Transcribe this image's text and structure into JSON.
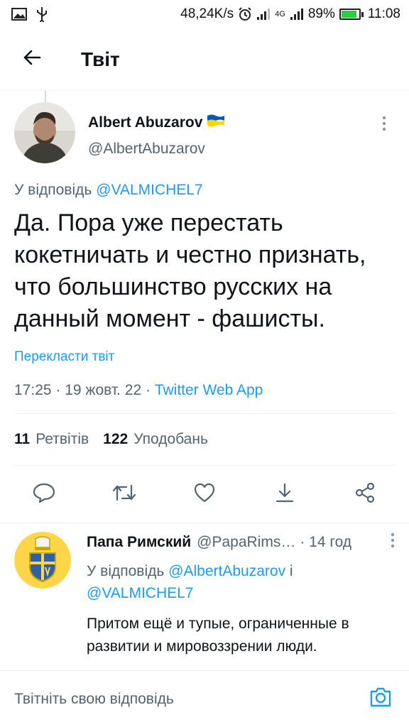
{
  "status_bar": {
    "speed": "48,24K/s",
    "network": "4G",
    "battery": "89%",
    "battery_level": 0.89,
    "time": "11:08"
  },
  "header": {
    "title": "Твіт"
  },
  "tweet": {
    "author_name": "Albert Abuzarov",
    "author_handle": "@AlbertAbuzarov",
    "reply_prefix": "У відповідь",
    "reply_to": "@VALMICHEL7",
    "text": "Да. Пора уже перестать кокетничать и честно признать, что большинство русских на данный момент - фашисты.",
    "translate": "Перекласти твіт",
    "meta": "17:25 · 19 жовт. 22 · ",
    "source": "Twitter Web App",
    "retweets_count": "11",
    "retweets_label": "Ретвітів",
    "likes_count": "122",
    "likes_label": "Уподобань"
  },
  "reply": {
    "name": "Папа Римский",
    "handle": "@PapaRims…",
    "time": "· 14 год",
    "reply_prefix": "У відповідь",
    "reply_to_1": "@AlbertAbuzarov",
    "reply_and": "і",
    "reply_to_2": "@VALMICHEL7",
    "text": "Притом ещё и тупые, ограниченные в развитии и мировоззрении люди."
  },
  "compose": {
    "placeholder": "Твітніть свою відповідь"
  },
  "colors": {
    "accent": "#1d9bf0",
    "secondary_text": "#536471",
    "primary_text": "#0f1419",
    "divider": "#eff3f4",
    "flag_blue": "#0057b7",
    "flag_yellow": "#ffd700"
  },
  "icons": [
    "image-icon",
    "usb-icon",
    "alarm-icon",
    "signal-icon",
    "battery-icon",
    "back-arrow-icon",
    "more-vertical-icon",
    "reply-icon",
    "retweet-icon",
    "like-icon",
    "bookmark-icon",
    "share-icon",
    "camera-icon",
    "ukraine-flag-icon"
  ]
}
